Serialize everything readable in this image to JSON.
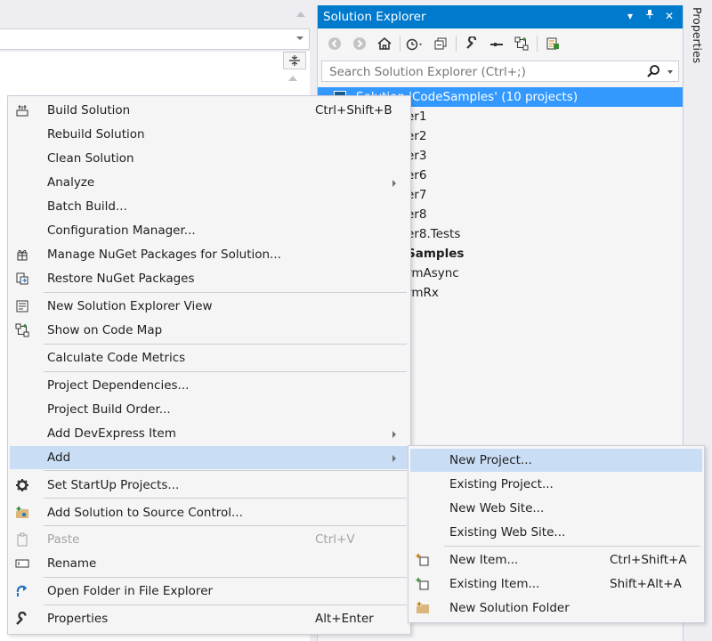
{
  "solution_explorer": {
    "title": "Solution Explorer",
    "title_buttons": [
      "▾",
      "❙",
      "✕"
    ],
    "search_placeholder": "Search Solution Explorer (Ctrl+;)",
    "tree": [
      {
        "label": "Solution 'CodeSamples' (10 projects)",
        "selected": true
      },
      {
        "label": "er1"
      },
      {
        "label": "er2"
      },
      {
        "label": "er3"
      },
      {
        "label": "er6"
      },
      {
        "label": "er7"
      },
      {
        "label": "er8"
      },
      {
        "label": "er8.Tests"
      },
      {
        "label": "Samples",
        "bold": true
      },
      {
        "label": "rmAsync"
      },
      {
        "label": "rmRx"
      }
    ]
  },
  "properties_rail": {
    "label": "Properties"
  },
  "context_menu": {
    "items": [
      {
        "label": "Build Solution",
        "shortcut": "Ctrl+Shift+B",
        "icon": "build-icon"
      },
      {
        "label": "Rebuild Solution"
      },
      {
        "label": "Clean Solution"
      },
      {
        "label": "Analyze",
        "submenu": true
      },
      {
        "label": "Batch Build..."
      },
      {
        "label": "Configuration Manager..."
      },
      {
        "label": "Manage NuGet Packages for Solution...",
        "icon": "nuget-icon"
      },
      {
        "label": "Restore NuGet Packages",
        "icon": "restore-icon"
      },
      {
        "label": "New Solution Explorer View",
        "icon": "new-view-icon"
      },
      {
        "label": "Show on Code Map",
        "icon": "code-map-icon"
      },
      {
        "label": "Calculate Code Metrics"
      },
      {
        "label": "Project Dependencies..."
      },
      {
        "label": "Project Build Order..."
      },
      {
        "label": "Add DevExpress Item",
        "submenu": true
      },
      {
        "label": "Add",
        "submenu": true,
        "highlighted": true
      },
      {
        "label": "Set StartUp Projects...",
        "icon": "gear-icon"
      },
      {
        "label": "Add Solution to Source Control...",
        "icon": "source-control-icon"
      },
      {
        "label": "Paste",
        "shortcut": "Ctrl+V",
        "icon": "paste-icon",
        "disabled": true
      },
      {
        "label": "Rename",
        "icon": "rename-icon"
      },
      {
        "label": "Open Folder in File Explorer",
        "icon": "open-folder-icon"
      },
      {
        "label": "Properties",
        "shortcut": "Alt+Enter",
        "icon": "wrench-icon"
      }
    ]
  },
  "add_submenu": {
    "items": [
      {
        "label": "New Project...",
        "highlighted": true
      },
      {
        "label": "Existing Project..."
      },
      {
        "label": "New Web Site..."
      },
      {
        "label": "Existing Web Site..."
      },
      {
        "label": "New Item...",
        "shortcut": "Ctrl+Shift+A",
        "icon": "new-item-icon"
      },
      {
        "label": "Existing Item...",
        "shortcut": "Shift+Alt+A",
        "icon": "existing-item-icon"
      },
      {
        "label": "New Solution Folder",
        "icon": "new-folder-icon"
      }
    ]
  },
  "colors": {
    "accent": "#007acc",
    "selection": "#3399ff",
    "menu_highlight": "#c9def5"
  }
}
